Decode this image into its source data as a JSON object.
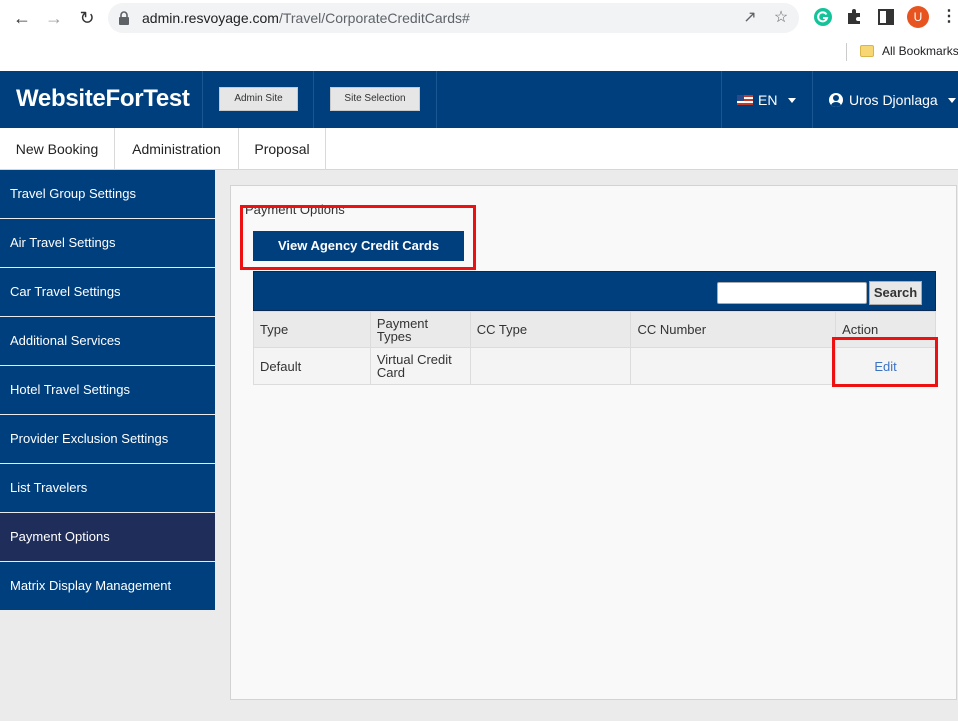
{
  "browser": {
    "url_host": "admin.resvoyage.com",
    "url_path": "/Travel/CorporateCreditCards#",
    "profile_initial": "U",
    "bookmarks_label": "All Bookmarks"
  },
  "header": {
    "brand": "WebsiteForTest",
    "admin_site_label": "Admin Site",
    "site_selection_label": "Site Selection",
    "language": "EN",
    "user_name": "Uros Djonlaga"
  },
  "topmenu": {
    "items": [
      "New Booking",
      "Administration",
      "Proposal"
    ]
  },
  "sidebar": {
    "items": [
      {
        "label": "Travel Group Settings"
      },
      {
        "label": "Air Travel Settings"
      },
      {
        "label": "Car Travel Settings"
      },
      {
        "label": "Additional Services"
      },
      {
        "label": "Hotel Travel Settings"
      },
      {
        "label": "Provider Exclusion Settings"
      },
      {
        "label": "List Travelers"
      },
      {
        "label": "Payment Options",
        "active": true
      },
      {
        "label": "Matrix Display Management"
      }
    ]
  },
  "main": {
    "title": "Payment Options",
    "view_button_label": "View Agency Credit Cards",
    "search_placeholder": "",
    "search_button_label": "Search",
    "columns": [
      "Type",
      "Payment Types",
      "CC Type",
      "CC Number",
      "Action"
    ],
    "rows": [
      {
        "type": "Default",
        "payment_types": "Virtual Credit Card",
        "cc_type": "",
        "cc_number": "",
        "action": "Edit"
      }
    ]
  },
  "colors": {
    "brand_blue": "#003f7d",
    "active_sidebar": "#1f2d5a",
    "highlight_red": "#ee1111",
    "link_blue": "#3b73c4"
  }
}
